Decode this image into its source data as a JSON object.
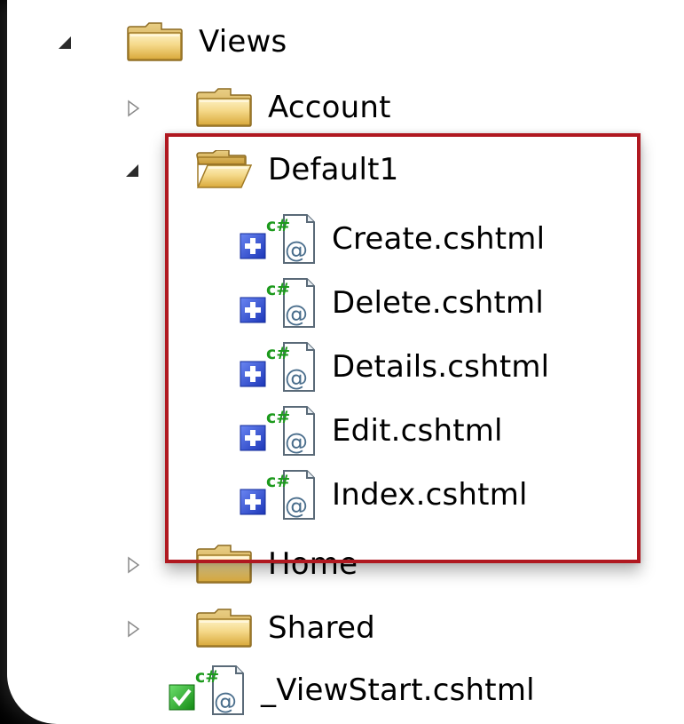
{
  "tree": {
    "views": {
      "label": "Views",
      "expanded": true
    },
    "account": {
      "label": "Account",
      "expanded": false
    },
    "default1": {
      "label": "Default1",
      "expanded": true
    },
    "files": [
      {
        "label": "Create.cshtml"
      },
      {
        "label": "Delete.cshtml"
      },
      {
        "label": "Details.cshtml"
      },
      {
        "label": "Edit.cshtml"
      },
      {
        "label": "Index.cshtml"
      }
    ],
    "home": {
      "label": "Home",
      "expanded": false
    },
    "shared": {
      "label": "Shared",
      "expanded": false
    },
    "viewstart": {
      "label": "_ViewStart.cshtml"
    }
  },
  "colors": {
    "highlight_border": "#b01820",
    "csharp_green": "#1d9a1d",
    "add_badge_blue": "#2f4fd0",
    "checked_badge_green": "#22a022",
    "folder_yellow": "#f2d27a"
  },
  "icons": {
    "collapse": "expanded-arrow-icon",
    "expand": "collapsed-arrow-icon",
    "folder": "folder-icon",
    "folder_open": "folder-open-icon",
    "cshtml": "cshtml-file-icon",
    "pending_add": "pending-add-badge-icon",
    "checked_in": "checked-in-badge-icon"
  }
}
